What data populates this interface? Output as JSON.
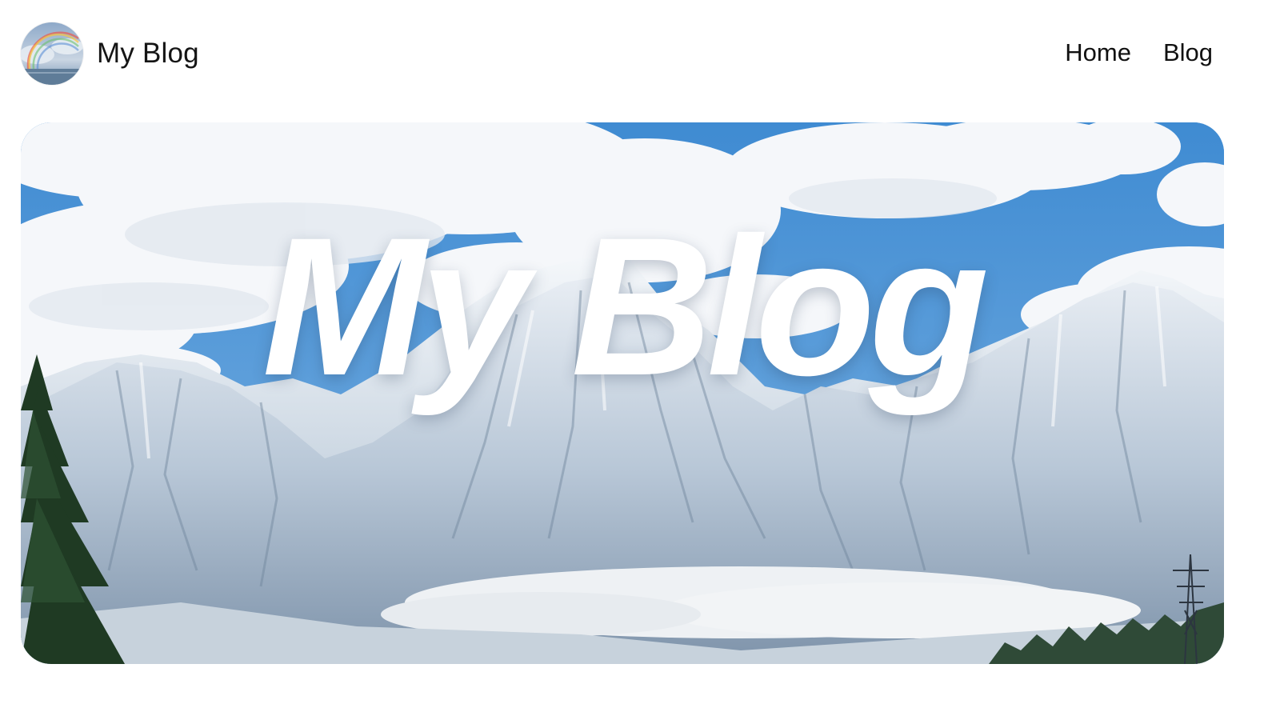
{
  "header": {
    "site_name": "My Blog",
    "avatar_icon": "rainbow-sky-avatar",
    "nav": {
      "home_label": "Home",
      "blog_label": "Blog"
    }
  },
  "hero": {
    "title": "My Blog",
    "image": "snowy-mountains-with-clouds"
  },
  "colors": {
    "text": "#111111",
    "background": "#ffffff",
    "sky": "#4d94d6"
  }
}
